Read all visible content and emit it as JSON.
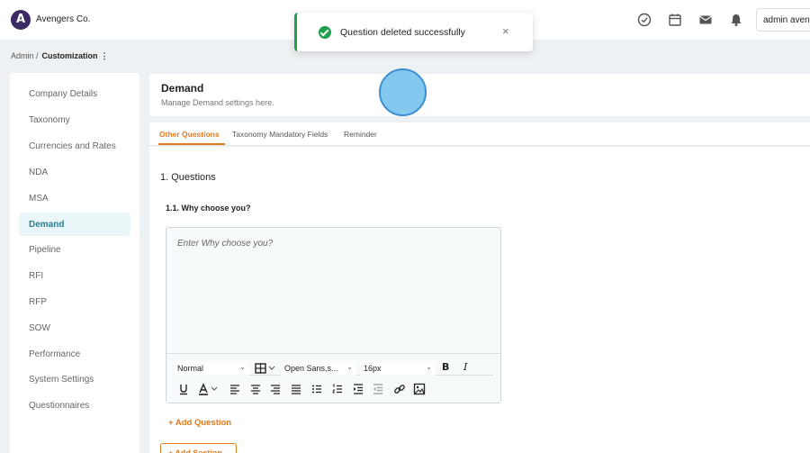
{
  "header": {
    "logo_letter": "A",
    "brand": "Avengers Co.",
    "user": "admin avengers",
    "icons": [
      "check-circle-icon",
      "calendar-icon",
      "mail-icon",
      "bell-icon"
    ]
  },
  "breadcrumb": {
    "root": "Admin /",
    "current": "Customization",
    "menu": "⋮"
  },
  "sidebar": {
    "items": [
      {
        "label": "Company Details"
      },
      {
        "label": "Taxonomy"
      },
      {
        "label": "Currencies and Rates"
      },
      {
        "label": "NDA"
      },
      {
        "label": "MSA"
      },
      {
        "label": "Demand",
        "active": true
      },
      {
        "label": "Pipeline"
      },
      {
        "label": "RFI"
      },
      {
        "label": "RFP"
      },
      {
        "label": "SOW"
      },
      {
        "label": "Performance"
      },
      {
        "label": "System Settings"
      },
      {
        "label": "Questionnaires"
      }
    ]
  },
  "main": {
    "title": "Demand",
    "subtitle": "Manage Demand settings here.",
    "tabs": [
      {
        "label": "Other Questions",
        "active": true
      },
      {
        "label": "Taxonomy Mandatory Fields"
      },
      {
        "label": "Reminder"
      }
    ],
    "section_title": "1. Questions",
    "question_label": "1.1. Why choose you?",
    "editor": {
      "placeholder": "Enter Why choose you?",
      "format": "Normal",
      "font": "Open Sans,s...",
      "size": "16px"
    },
    "add_question": "+ Add Question",
    "add_section": "+ Add Section"
  },
  "toast": {
    "message": "Question deleted successfully",
    "close": "×"
  },
  "colors": {
    "accent": "#e07a1f",
    "active_sidebar": "#2a7f90",
    "success": "#1fa04a"
  }
}
